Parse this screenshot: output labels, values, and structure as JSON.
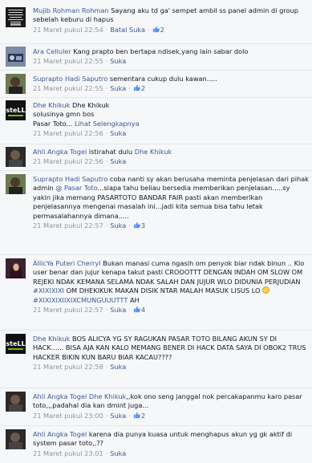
{
  "comments": [
    {
      "name": "Mujib Rohman Rohman",
      "text": "Sayang aku td ga' sempet ambil ss panel admin di group sebelah keburu di hapus",
      "time": "21 Maret pukul 22:54",
      "actions": [
        "Batal Suka"
      ],
      "likes": "2",
      "avatar_text": "HANYA TEMAN YANG SUSAH DISAAT SUSAH SENANG DISAAT SENANG"
    },
    {
      "name": "Ara Celluler",
      "text": "Kang prapto ben bertapa ndisek,yang lain sabar dolo",
      "time": "21 Maret pukul 22:55",
      "actions": [
        "Suka"
      ]
    },
    {
      "name": "Suprapto Hadi Saputro",
      "text": "sementara cukup dulu kawan.....",
      "time": "21 Maret pukul 22:55",
      "actions": [
        "Suka"
      ],
      "likes": "2"
    },
    {
      "name": "Dhe Khikuk",
      "text_line1": "Dhe Khikuk",
      "text_line2": "solusinya gmn bos",
      "text_line3": "Pasar Toto...",
      "see_more": "Lihat Selengkapnya",
      "time": "21 Maret pukul 22:56",
      "actions": [
        "Suka"
      ],
      "avatar_text": "steLL"
    },
    {
      "name": "Ahli Angka Togel",
      "text": "istirahat dulu",
      "mention": "Dhe Khikuk",
      "time": "21 Maret pukul 22:56",
      "actions": [
        "Suka"
      ]
    },
    {
      "name": "Suprapto Hadi Saputro",
      "text_part1": "coba nanti sy akan berusaha meminta penjelasan dari pihak admin",
      "tag": "@ Pasar Toto",
      "text_part2": "...siapa tahu beliau bersedia memberikan penjelasan.....sy yakin jika memang PASARTOTO BANDAR FAIR pasti akan memberikan penjelasannya mengenai masalah ini...jadi kita semua bisa tahu letak permasalahannya dimana.....",
      "time": "21 Maret pukul 22:57",
      "actions": [
        "Suka"
      ],
      "likes": "3"
    },
    {
      "name": "AllicYa Puteri Cherryl",
      "text_part1": "Bukan manasi cuma ngasih om penyok biar ndak binun .. Klo user benar dan jujur kenapa takut pasti CROOOTTT DENGAN INDAH OM SLOW OM REJEKI NDAK KEMANA SELAMA NDAK SALAH DAN JUJUR WLO DIDUNIA PERJUDIAN",
      "hashtag1": "#XIXIXIXI",
      "text_part2": "OM DHEKIKUK MAKAN DISIK NTAR MALAH MASUK LISUS LO",
      "hashtag2": "#XIXIXIXIIXIXCMUNGUUUTTT",
      "text_part3": "AH",
      "time": "21 Maret pukul 22:57",
      "actions": [
        "Suka"
      ],
      "likes": "4"
    },
    {
      "name": "Dhe Khikuk",
      "text": "BOS ALICYA YG SY RAGUKAN PASAR TOTO BILANG AKUN SY DI HACK...... BISA AJA KAN KALO MEMANG BENER DI HACK DATA SAYA DI OBOK2 TRUS HACKER BIKIN KUN BARU BIAR KACAU????",
      "time": "21 Maret pukul 22:58",
      "actions": [
        "Suka"
      ],
      "avatar_text": "steLL"
    },
    {
      "name": "Ahli Angka Togel",
      "mention": "Dhe Khikuk",
      "text": ",,kok ono seng janggal nok percakapanmu karo pasar toto,,,padahal dia kan dmint juga...",
      "time": "21 Maret pukul 23:00",
      "actions": [
        "Suka"
      ],
      "likes": "2"
    },
    {
      "name": "Ahli Angka Togel",
      "text": "karena dia punya kuasa untuk menghapus akun yg gk aktif di system pasar toto,,??",
      "time": "21 Maret pukul 23:01",
      "actions": [
        "Suka"
      ]
    }
  ],
  "colors": {
    "link": "#3b5998",
    "meta": "#90949c",
    "text": "#141823",
    "background": "#f6f7f9"
  },
  "icons": {
    "like": "thumbs-up-icon"
  }
}
